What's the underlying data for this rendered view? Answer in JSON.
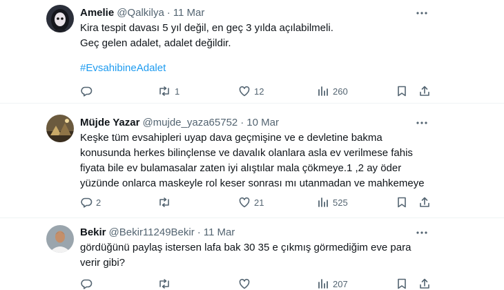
{
  "tweets": [
    {
      "name": "Amelie",
      "handle": "@Qalkilya",
      "separator": "·",
      "date": "11 Mar",
      "lines": [
        "Kira tespit davası 5 yıl değil, en geç 3 yılda açılabilmeli.",
        "Geç gelen adalet, adalet değildir."
      ],
      "hashtag": "#EvsahibineAdalet",
      "replies": "",
      "retweets": "1",
      "likes": "12",
      "views": "260"
    },
    {
      "name": "Müjde Yazar",
      "handle": "@mujde_yaza65752",
      "separator": "·",
      "date": "10 Mar",
      "lines": [
        "Keşke tüm evsahipleri uyap dava geçmişine ve e devletine bakma",
        "konusunda herkes bilinçlense ve davalık olanlara asla ev verilmese fahis",
        "fiyata bile ev bulamasalar zaten  iyi  alıştılar mala çökmeye.1 ,2 ay öder",
        "yüzünde onlarca maskeyle rol keser sonrası mı utanmadan ve mahkemeye"
      ],
      "replies": "2",
      "retweets": "",
      "likes": "21",
      "views": "525"
    },
    {
      "name": "Bekir",
      "handle": "@Bekir11249Bekir",
      "separator": "·",
      "date": "11 Mar",
      "lines": [
        "gördüğünü paylaş istersen lafa bak 30 35 e çıkmış görmediğim eve para",
        "verir gibi?"
      ],
      "replies": "",
      "retweets": "",
      "likes": "",
      "views": "207"
    }
  ],
  "icons": {
    "reply": "reply-bubble-icon",
    "retweet": "retweet-arrows-icon",
    "like": "heart-icon",
    "views": "views-bar-chart-icon",
    "bookmark": "bookmark-icon",
    "share": "share-upload-icon",
    "more": "more-dots-icon"
  },
  "colors": {
    "text": "#0f1419",
    "secondary": "#536471",
    "hashtag": "#1d9bf0",
    "divider": "#eff3f4"
  }
}
